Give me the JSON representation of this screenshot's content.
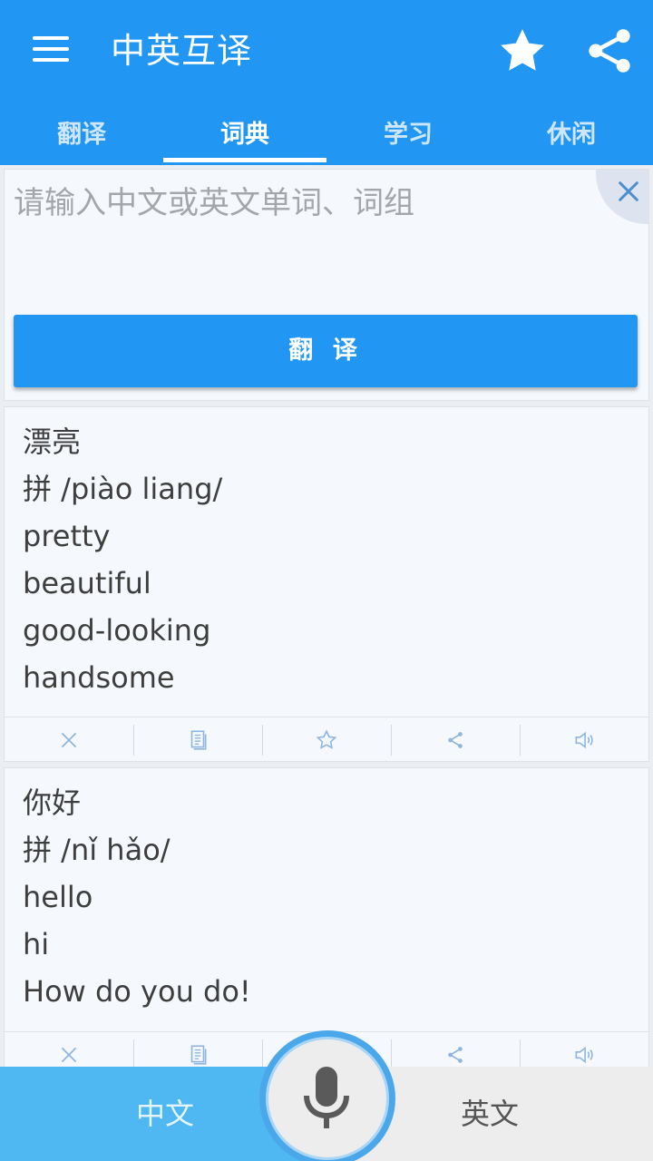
{
  "app": {
    "title": "中英互译",
    "colors": {
      "primary": "#2196f3",
      "left_bottom": "#4fb7f1",
      "card": "#f5f8fd"
    }
  },
  "header": {
    "menu_icon": "hamburger-menu-icon",
    "favorite_icon": "star-icon",
    "share_icon": "share-icon"
  },
  "tabs": [
    {
      "label": "翻译",
      "active": false
    },
    {
      "label": "词典",
      "active": true
    },
    {
      "label": "学习",
      "active": false
    },
    {
      "label": "休闲",
      "active": false
    }
  ],
  "input": {
    "placeholder": "请输入中文或英文单词、词组",
    "clear_icon": "close-icon",
    "translate_button": "翻 译"
  },
  "results": [
    {
      "word": "漂亮",
      "pinyin": "拼 /piào liang/",
      "meanings": [
        "pretty",
        "beautiful",
        "good-looking",
        "handsome"
      ]
    },
    {
      "word": "你好",
      "pinyin": "拼 /nǐ hǎo/",
      "meanings": [
        "hello",
        "hi",
        "How do you do!"
      ]
    }
  ],
  "result_actions": [
    "close-icon",
    "copy-icon",
    "star-outline-icon",
    "share-icon",
    "speaker-icon"
  ],
  "bottom": {
    "left_language": "中文",
    "right_language": "英文",
    "mic_icon": "microphone-icon"
  }
}
